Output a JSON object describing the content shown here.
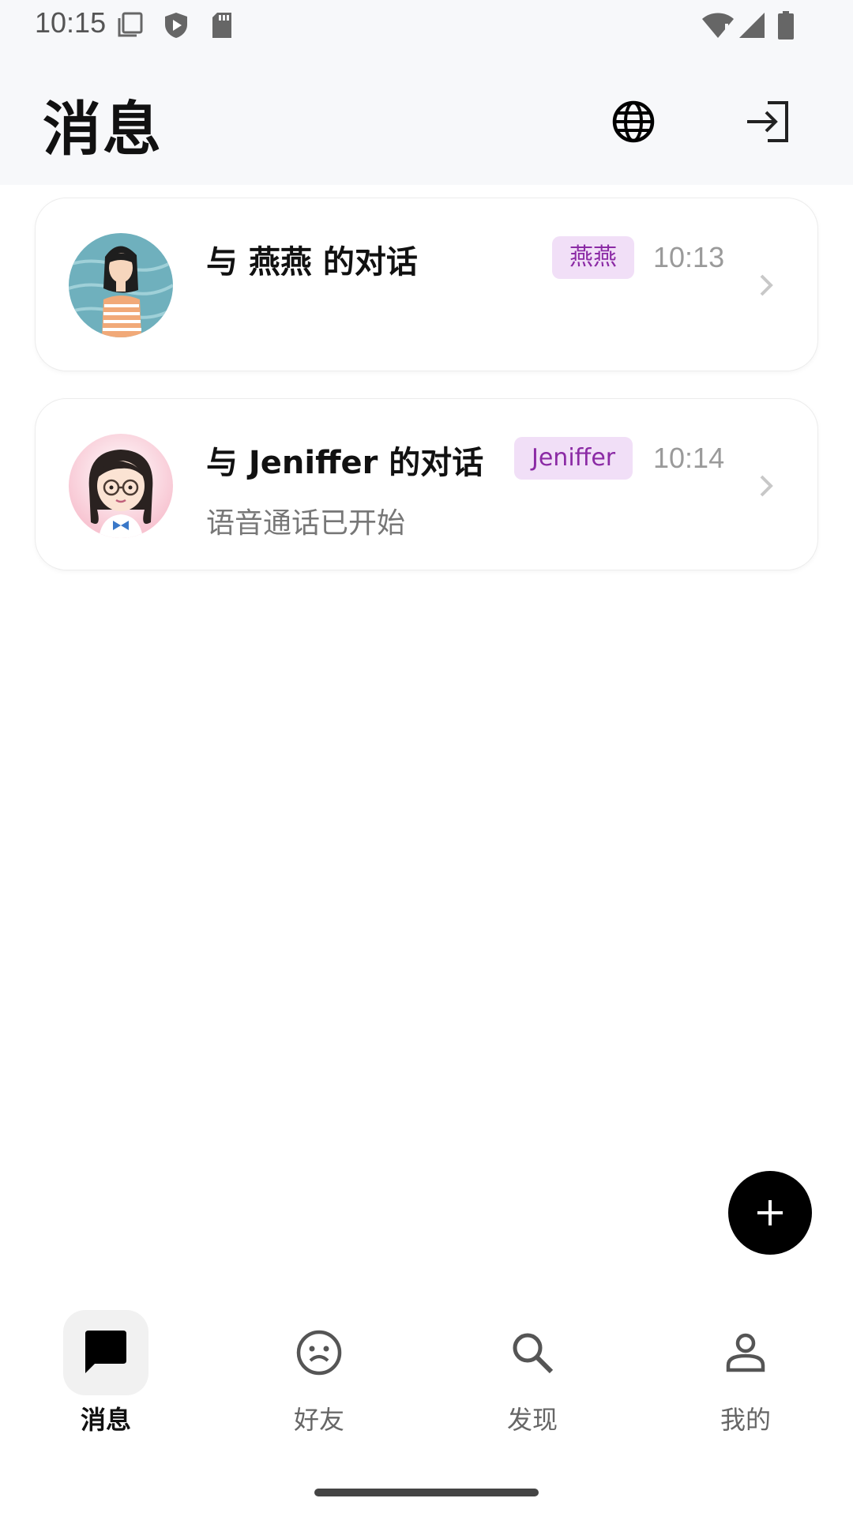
{
  "status_bar": {
    "time": "10:15",
    "left_icons": [
      "screenshot-icon",
      "shield-play-icon",
      "sd-card-icon"
    ],
    "right_icons": [
      "wifi-alert-icon",
      "signal-icon",
      "battery-icon"
    ]
  },
  "header": {
    "title": "消息",
    "actions": [
      "globe-icon",
      "login-icon"
    ]
  },
  "conversations": [
    {
      "title": "与 燕燕 的对话",
      "badge": "燕燕",
      "time": "10:13",
      "preview": "",
      "avatar": "avatar-yanyan"
    },
    {
      "title": "与 Jeniffer 的对话",
      "badge": "Jeniffer",
      "time": "10:14",
      "preview": "语音通话已开始",
      "avatar": "avatar-jeniffer"
    }
  ],
  "fab": {
    "icon": "plus-icon"
  },
  "bottom_nav": {
    "items": [
      {
        "label": "消息",
        "icon": "chat-icon",
        "active": true
      },
      {
        "label": "好友",
        "icon": "smiley-icon",
        "active": false
      },
      {
        "label": "发现",
        "icon": "search-icon",
        "active": false
      },
      {
        "label": "我的",
        "icon": "person-icon",
        "active": false
      }
    ]
  },
  "colors": {
    "badge_bg": "#f1dff7",
    "badge_text": "#8b2aa5",
    "header_bg": "#f7f8fa",
    "fab_bg": "#000000"
  }
}
